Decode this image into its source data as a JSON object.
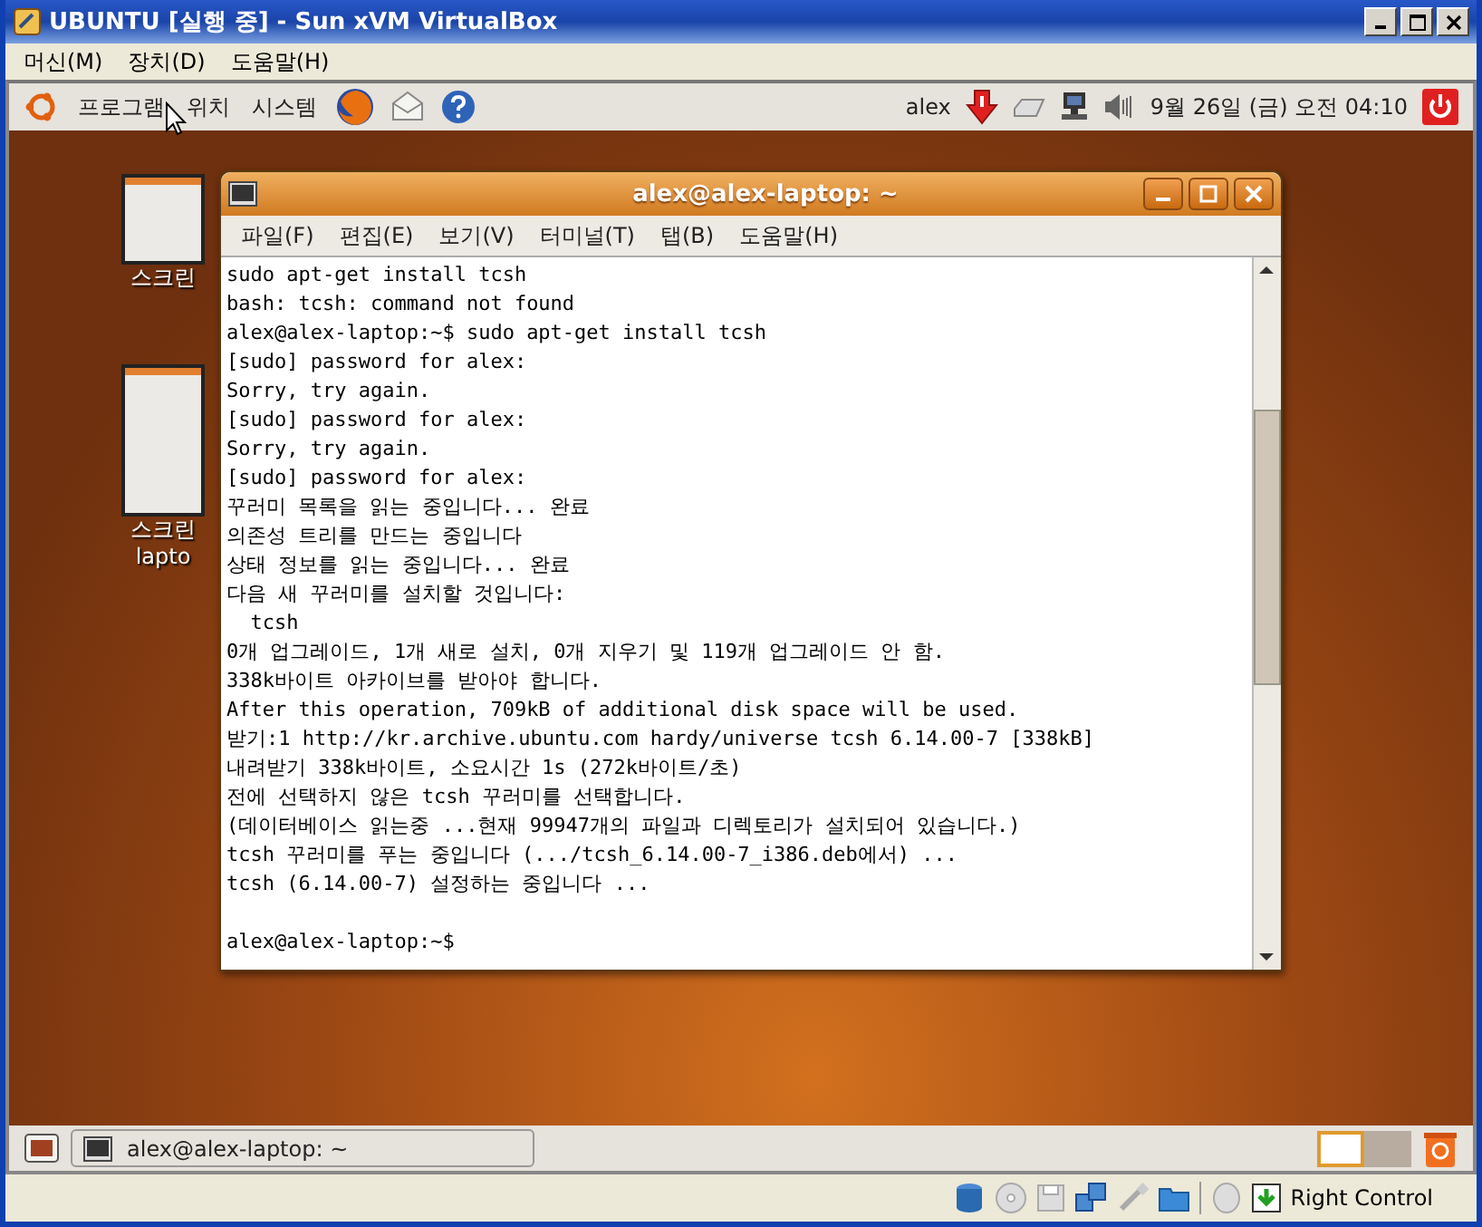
{
  "window": {
    "title": "UBUNTU [실행 중] - Sun xVM VirtualBox"
  },
  "menu_bar": [
    {
      "label": "머신(M)"
    },
    {
      "label": "장치(D)"
    },
    {
      "label": "도움말(H)"
    }
  ],
  "top_panel": {
    "menus": [
      {
        "label": "프로그램"
      },
      {
        "label": "위치"
      },
      {
        "label": "시스템"
      }
    ],
    "user": "alex",
    "clock": "9월 26일 (금) 오전 04:10"
  },
  "desktop_icons": [
    {
      "label": "스크린"
    },
    {
      "label": "스크린",
      "label_2": "lapto"
    }
  ],
  "terminal": {
    "title": "alex@alex-laptop: ~",
    "menus": [
      {
        "label": "파일(F)"
      },
      {
        "label": "편집(E)"
      },
      {
        "label": "보기(V)"
      },
      {
        "label": "터미널(T)"
      },
      {
        "label": "탭(B)"
      },
      {
        "label": "도움말(H)"
      }
    ],
    "lines": [
      "sudo apt-get install tcsh",
      "bash: tcsh: command not found",
      "alex@alex-laptop:~$ sudo apt-get install tcsh",
      "[sudo] password for alex:",
      "Sorry, try again.",
      "[sudo] password for alex:",
      "Sorry, try again.",
      "[sudo] password for alex:",
      "꾸러미 목록을 읽는 중입니다... 완료",
      "의존성 트리를 만드는 중입니다",
      "상태 정보를 읽는 중입니다... 완료",
      "다음 새 꾸러미를 설치할 것입니다:",
      "  tcsh",
      "0개 업그레이드, 1개 새로 설치, 0개 지우기 및 119개 업그레이드 안 함.",
      "338k바이트 아카이브를 받아야 합니다.",
      "After this operation, 709kB of additional disk space will be used.",
      "받기:1 http://kr.archive.ubuntu.com hardy/universe tcsh 6.14.00-7 [338kB]",
      "내려받기 338k바이트, 소요시간 1s (272k바이트/초)",
      "전에 선택하지 않은 tcsh 꾸러미를 선택합니다.",
      "(데이터베이스 읽는중 ...현재 99947개의 파일과 디렉토리가 설치되어 있습니다.)",
      "tcsh 꾸러미를 푸는 중입니다 (.../tcsh_6.14.00-7_i386.deb에서) ...",
      "tcsh (6.14.00-7) 설정하는 중입니다 ..."
    ],
    "prompt": "alex@alex-laptop:~$"
  },
  "bottom_panel": {
    "tasks": [
      {
        "label": "alex@alex-laptop: ~",
        "selected": false
      }
    ],
    "workspaces": [
      {
        "selected": true
      },
      {
        "selected": false
      }
    ]
  },
  "status_bar": {
    "host_key": "Right Control"
  }
}
